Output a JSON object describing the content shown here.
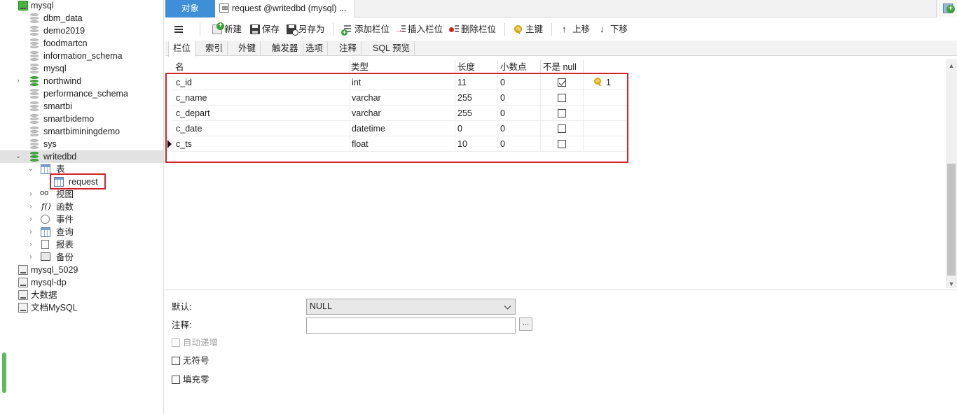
{
  "sidebar": {
    "items": [
      {
        "label": "mysql",
        "type": "connection"
      },
      {
        "label": "dbm_data",
        "type": "db"
      },
      {
        "label": "demo2019",
        "type": "db"
      },
      {
        "label": "foodmartcn",
        "type": "db"
      },
      {
        "label": "information_schema",
        "type": "db"
      },
      {
        "label": "mysql",
        "type": "db"
      },
      {
        "label": "northwind",
        "type": "db"
      },
      {
        "label": "performance_schema",
        "type": "db"
      },
      {
        "label": "smartbi",
        "type": "db"
      },
      {
        "label": "smartbidemo",
        "type": "db"
      },
      {
        "label": "smartbiminingdemo",
        "type": "db"
      },
      {
        "label": "sys",
        "type": "db"
      },
      {
        "label": "writedbd",
        "type": "db"
      },
      {
        "label": "表",
        "type": "folder-tables"
      },
      {
        "label": "request",
        "type": "table"
      },
      {
        "label": "视图",
        "type": "folder-views"
      },
      {
        "label": "函数",
        "type": "folder-functions"
      },
      {
        "label": "事件",
        "type": "folder-events"
      },
      {
        "label": "查询",
        "type": "folder-queries"
      },
      {
        "label": "报表",
        "type": "folder-reports"
      },
      {
        "label": "备份",
        "type": "folder-backups"
      },
      {
        "label": "mysql_5029",
        "type": "connection"
      },
      {
        "label": "mysql-dp",
        "type": "connection"
      },
      {
        "label": "大数据",
        "type": "connection"
      },
      {
        "label": "文档MySQL",
        "type": "connection"
      }
    ]
  },
  "tabs": {
    "objects": "对象",
    "active": "request @writedbd (mysql) ..."
  },
  "toolbar": {
    "new": "新建",
    "save": "保存",
    "save_as": "另存为",
    "add_column": "添加栏位",
    "insert_column": "插入栏位",
    "delete_column": "删除栏位",
    "primary_key": "主键",
    "move_up": "上移",
    "move_down": "下移"
  },
  "subtabs": [
    "栏位",
    "索引",
    "外键",
    "触发器",
    "选项",
    "注释",
    "SQL 预览"
  ],
  "grid": {
    "headers": [
      "名",
      "类型",
      "长度",
      "小数点",
      "不是 null"
    ],
    "rows": [
      {
        "name": "c_id",
        "type": "int",
        "length": "11",
        "decimals": "0",
        "not_null": true,
        "key": "1"
      },
      {
        "name": "c_name",
        "type": "varchar",
        "length": "255",
        "decimals": "0",
        "not_null": false,
        "key": ""
      },
      {
        "name": "c_depart",
        "type": "varchar",
        "length": "255",
        "decimals": "0",
        "not_null": false,
        "key": ""
      },
      {
        "name": "c_date",
        "type": "datetime",
        "length": "0",
        "decimals": "0",
        "not_null": false,
        "key": ""
      },
      {
        "name": "c_ts",
        "type": "float",
        "length": "10",
        "decimals": "0",
        "not_null": false,
        "key": ""
      }
    ]
  },
  "props": {
    "default_label": "默认:",
    "default_value": "NULL",
    "comment_label": "注释:",
    "comment_value": "",
    "comment_button": "...",
    "auto_increment": "自动递增",
    "unsigned": "无符号",
    "zerofill": "填充零"
  },
  "colors": {
    "accent": "#3e8fd8",
    "highlight_box": "#d2232a",
    "db_active": "#46b33e"
  }
}
